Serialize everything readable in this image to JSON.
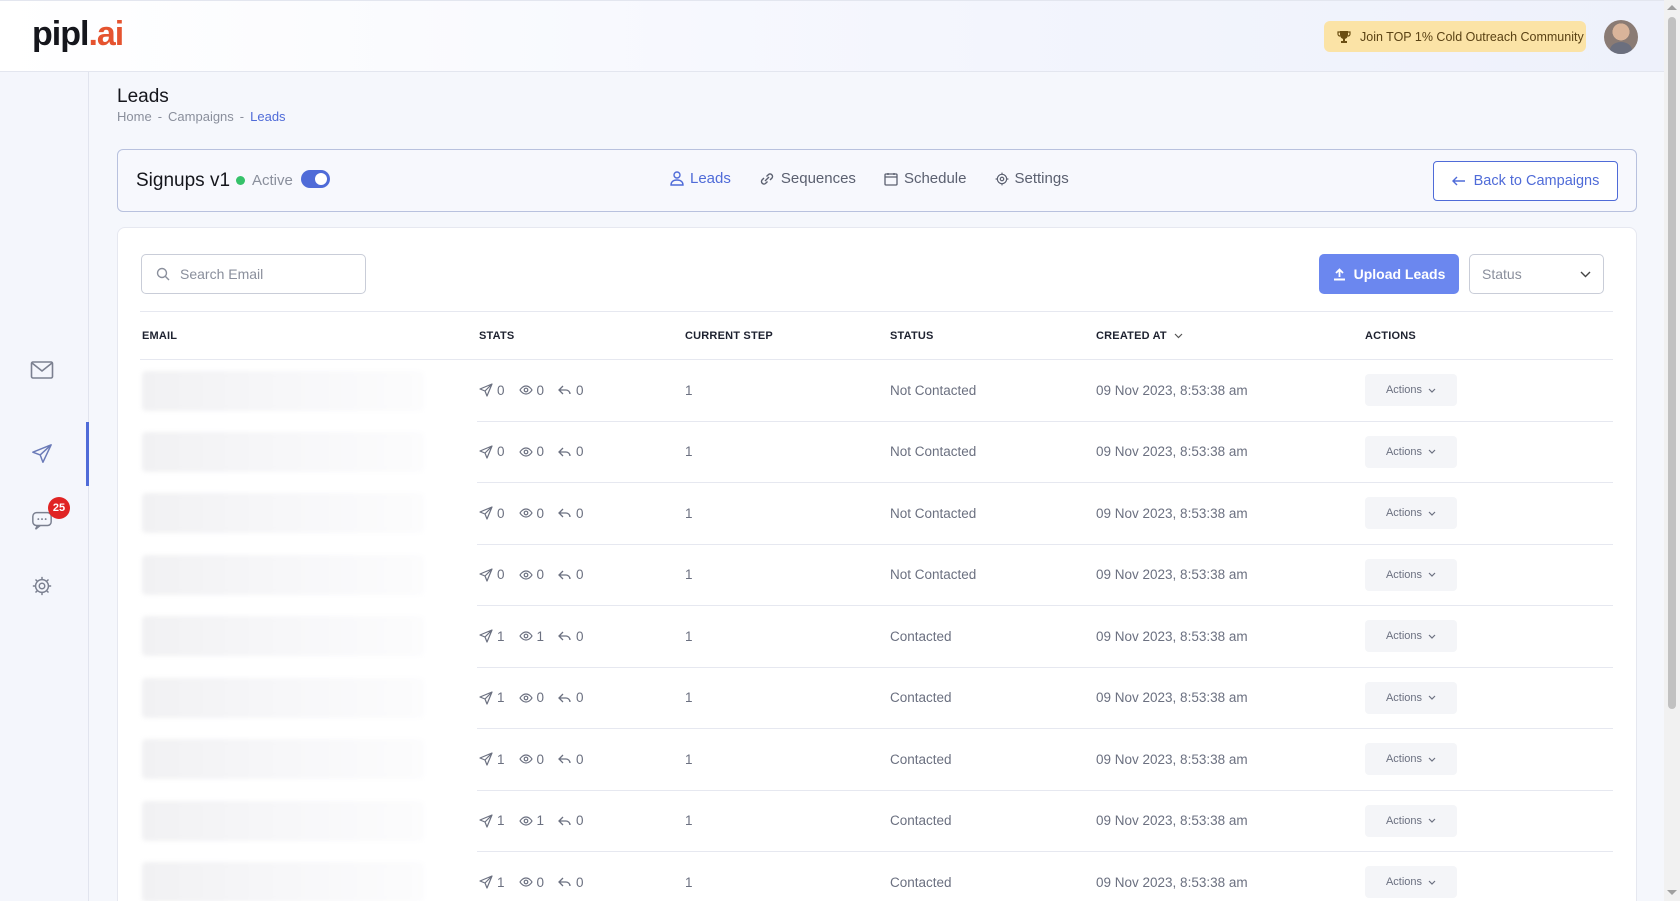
{
  "brand": {
    "name_main": "pipl",
    "name_ai": ".ai",
    "accent": "#4f6bd8"
  },
  "header": {
    "community_label": "Join TOP 1% Cold Outreach Community"
  },
  "sidebar": {
    "items": [
      {
        "name": "mail",
        "icon": "mail-icon"
      },
      {
        "name": "campaigns",
        "icon": "send-icon",
        "active": true
      },
      {
        "name": "inbox",
        "icon": "chat-icon",
        "badge": "25"
      },
      {
        "name": "settings",
        "icon": "gear-icon"
      }
    ]
  },
  "page": {
    "title": "Leads",
    "breadcrumb": [
      "Home",
      "Campaigns",
      "Leads"
    ],
    "sep": "-"
  },
  "campaign": {
    "name": "Signups v1",
    "status": "Active",
    "tabs": [
      {
        "label": "Leads",
        "icon": "user-icon"
      },
      {
        "label": "Sequences",
        "icon": "link-icon"
      },
      {
        "label": "Schedule",
        "icon": "calendar-icon"
      },
      {
        "label": "Settings",
        "icon": "gear-icon"
      }
    ],
    "back_label": "Back to Campaigns"
  },
  "toolbar": {
    "search_placeholder": "Search Email",
    "upload_label": "Upload Leads",
    "status_placeholder": "Status"
  },
  "table": {
    "headers": [
      "EMAIL",
      "STATS",
      "CURRENT STEP",
      "STATUS",
      "CREATED AT",
      "ACTIONS"
    ],
    "rows": [
      {
        "sent": "0",
        "opened": "0",
        "replied": "0",
        "step": "1",
        "status": "Not Contacted",
        "created": "09 Nov 2023, 8:53:38 am",
        "action": "Actions"
      },
      {
        "sent": "0",
        "opened": "0",
        "replied": "0",
        "step": "1",
        "status": "Not Contacted",
        "created": "09 Nov 2023, 8:53:38 am",
        "action": "Actions"
      },
      {
        "sent": "0",
        "opened": "0",
        "replied": "0",
        "step": "1",
        "status": "Not Contacted",
        "created": "09 Nov 2023, 8:53:38 am",
        "action": "Actions"
      },
      {
        "sent": "0",
        "opened": "0",
        "replied": "0",
        "step": "1",
        "status": "Not Contacted",
        "created": "09 Nov 2023, 8:53:38 am",
        "action": "Actions"
      },
      {
        "sent": "1",
        "opened": "1",
        "replied": "0",
        "step": "1",
        "status": "Contacted",
        "created": "09 Nov 2023, 8:53:38 am",
        "action": "Actions"
      },
      {
        "sent": "1",
        "opened": "0",
        "replied": "0",
        "step": "1",
        "status": "Contacted",
        "created": "09 Nov 2023, 8:53:38 am",
        "action": "Actions"
      },
      {
        "sent": "1",
        "opened": "0",
        "replied": "0",
        "step": "1",
        "status": "Contacted",
        "created": "09 Nov 2023, 8:53:38 am",
        "action": "Actions"
      },
      {
        "sent": "1",
        "opened": "1",
        "replied": "0",
        "step": "1",
        "status": "Contacted",
        "created": "09 Nov 2023, 8:53:38 am",
        "action": "Actions"
      },
      {
        "sent": "1",
        "opened": "0",
        "replied": "0",
        "step": "1",
        "status": "Contacted",
        "created": "09 Nov 2023, 8:53:38 am",
        "action": "Actions"
      }
    ]
  }
}
